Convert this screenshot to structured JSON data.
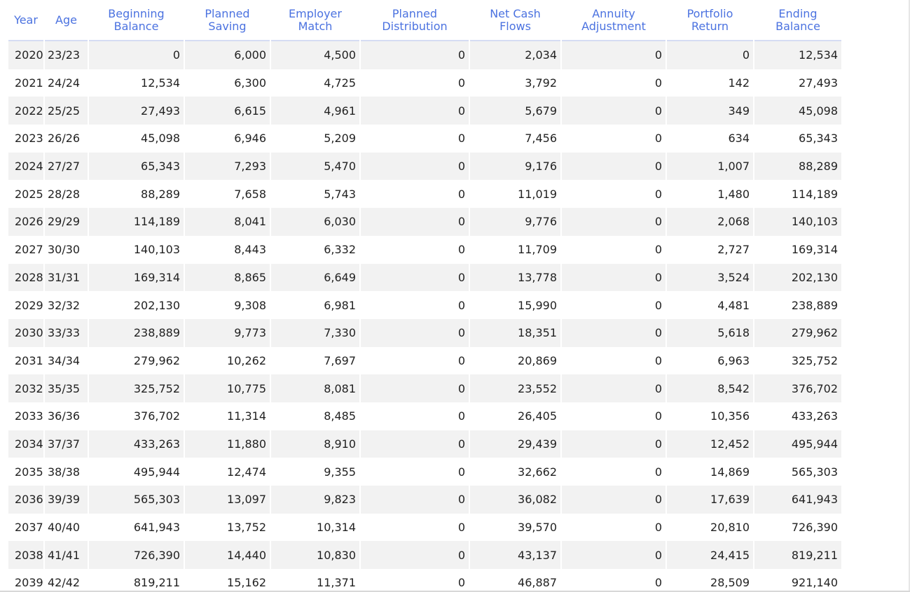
{
  "table": {
    "headers": [
      [
        "Year"
      ],
      [
        "Age"
      ],
      [
        "Beginning",
        "Balance"
      ],
      [
        "Planned",
        "Saving"
      ],
      [
        "Employer",
        "Match"
      ],
      [
        "Planned",
        "Distribution"
      ],
      [
        "Net Cash",
        "Flows"
      ],
      [
        "Annuity",
        "Adjustment"
      ],
      [
        "Portfolio",
        "Return"
      ],
      [
        "Ending",
        "Balance"
      ]
    ],
    "rows": [
      [
        "2020",
        "23/23",
        "0",
        "6,000",
        "4,500",
        "0",
        "2,034",
        "0",
        "0",
        "12,534"
      ],
      [
        "2021",
        "24/24",
        "12,534",
        "6,300",
        "4,725",
        "0",
        "3,792",
        "0",
        "142",
        "27,493"
      ],
      [
        "2022",
        "25/25",
        "27,493",
        "6,615",
        "4,961",
        "0",
        "5,679",
        "0",
        "349",
        "45,098"
      ],
      [
        "2023",
        "26/26",
        "45,098",
        "6,946",
        "5,209",
        "0",
        "7,456",
        "0",
        "634",
        "65,343"
      ],
      [
        "2024",
        "27/27",
        "65,343",
        "7,293",
        "5,470",
        "0",
        "9,176",
        "0",
        "1,007",
        "88,289"
      ],
      [
        "2025",
        "28/28",
        "88,289",
        "7,658",
        "5,743",
        "0",
        "11,019",
        "0",
        "1,480",
        "114,189"
      ],
      [
        "2026",
        "29/29",
        "114,189",
        "8,041",
        "6,030",
        "0",
        "9,776",
        "0",
        "2,068",
        "140,103"
      ],
      [
        "2027",
        "30/30",
        "140,103",
        "8,443",
        "6,332",
        "0",
        "11,709",
        "0",
        "2,727",
        "169,314"
      ],
      [
        "2028",
        "31/31",
        "169,314",
        "8,865",
        "6,649",
        "0",
        "13,778",
        "0",
        "3,524",
        "202,130"
      ],
      [
        "2029",
        "32/32",
        "202,130",
        "9,308",
        "6,981",
        "0",
        "15,990",
        "0",
        "4,481",
        "238,889"
      ],
      [
        "2030",
        "33/33",
        "238,889",
        "9,773",
        "7,330",
        "0",
        "18,351",
        "0",
        "5,618",
        "279,962"
      ],
      [
        "2031",
        "34/34",
        "279,962",
        "10,262",
        "7,697",
        "0",
        "20,869",
        "0",
        "6,963",
        "325,752"
      ],
      [
        "2032",
        "35/35",
        "325,752",
        "10,775",
        "8,081",
        "0",
        "23,552",
        "0",
        "8,542",
        "376,702"
      ],
      [
        "2033",
        "36/36",
        "376,702",
        "11,314",
        "8,485",
        "0",
        "26,405",
        "0",
        "10,356",
        "433,263"
      ],
      [
        "2034",
        "37/37",
        "433,263",
        "11,880",
        "8,910",
        "0",
        "29,439",
        "0",
        "12,452",
        "495,944"
      ],
      [
        "2035",
        "38/38",
        "495,944",
        "12,474",
        "9,355",
        "0",
        "32,662",
        "0",
        "14,869",
        "565,303"
      ],
      [
        "2036",
        "39/39",
        "565,303",
        "13,097",
        "9,823",
        "0",
        "36,082",
        "0",
        "17,639",
        "641,943"
      ],
      [
        "2037",
        "40/40",
        "641,943",
        "13,752",
        "10,314",
        "0",
        "39,570",
        "0",
        "20,810",
        "726,390"
      ],
      [
        "2038",
        "41/41",
        "726,390",
        "14,440",
        "10,830",
        "0",
        "43,137",
        "0",
        "24,415",
        "819,211"
      ],
      [
        "2039",
        "42/42",
        "819,211",
        "15,162",
        "11,371",
        "0",
        "46,887",
        "0",
        "28,509",
        "921,140"
      ]
    ]
  },
  "colors": {
    "header_text": "#4b72e0",
    "header_rule": "#d6dcf3",
    "stripe": "#f2f2f2",
    "cell_text": "#222222"
  }
}
